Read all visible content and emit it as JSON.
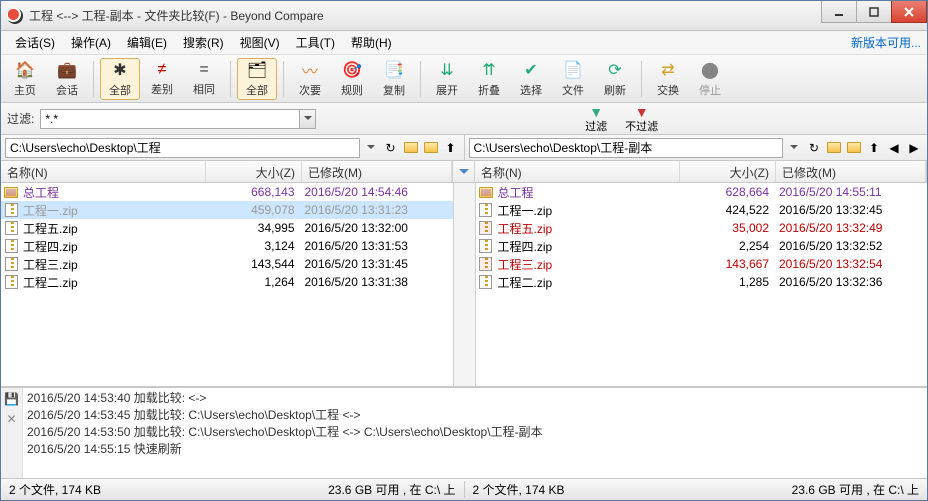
{
  "title": "工程 <--> 工程-副本 - 文件夹比较(F) - Beyond Compare",
  "update_link": "新版本可用...",
  "menu": [
    "会话(S)",
    "操作(A)",
    "编辑(E)",
    "搜索(R)",
    "视图(V)",
    "工具(T)",
    "帮助(H)"
  ],
  "toolbar": {
    "home": "主页",
    "session": "会话",
    "all": "全部",
    "diff": "差别",
    "same": "相同",
    "all2": "全部",
    "next": "次要",
    "rules": "规则",
    "copy": "复制",
    "expand": "展开",
    "collapse": "折叠",
    "select": "选择",
    "file": "文件",
    "refresh": "刷新",
    "swap": "交换",
    "stop": "停止"
  },
  "filter": {
    "label": "过滤:",
    "value": "*.*",
    "apply": "过滤",
    "unapply": "不过滤"
  },
  "paths": {
    "left": "C:\\Users\\echo\\Desktop\\工程",
    "right": "C:\\Users\\echo\\Desktop\\工程-副本"
  },
  "columns": {
    "name": "名称(N)",
    "size": "大小(Z)",
    "modified": "已修改(M)"
  },
  "left_rows": [
    {
      "type": "dir",
      "name": "总工程",
      "size": "668,143",
      "mod": "2016/5/20 14:54:46",
      "cls": "dir"
    },
    {
      "type": "zip",
      "name": "工程一.zip",
      "size": "459,078",
      "mod": "2016/5/20 13:31:23",
      "cls": "ghost selected"
    },
    {
      "type": "zip",
      "name": "工程五.zip",
      "size": "34,995",
      "mod": "2016/5/20 13:32:00",
      "cls": ""
    },
    {
      "type": "zip",
      "name": "工程四.zip",
      "size": "3,124",
      "mod": "2016/5/20 13:31:53",
      "cls": ""
    },
    {
      "type": "zip",
      "name": "工程三.zip",
      "size": "143,544",
      "mod": "2016/5/20 13:31:45",
      "cls": ""
    },
    {
      "type": "zip",
      "name": "工程二.zip",
      "size": "1,264",
      "mod": "2016/5/20 13:31:38",
      "cls": ""
    }
  ],
  "right_rows": [
    {
      "type": "dir",
      "name": "总工程",
      "size": "628,664",
      "mod": "2016/5/20 14:55:11",
      "cls": "dir"
    },
    {
      "type": "zip",
      "name": "工程一.zip",
      "size": "424,522",
      "mod": "2016/5/20 13:32:45",
      "cls": ""
    },
    {
      "type": "zip",
      "name": "工程五.zip",
      "size": "35,002",
      "mod": "2016/5/20 13:32:49",
      "cls": "diff"
    },
    {
      "type": "zip",
      "name": "工程四.zip",
      "size": "2,254",
      "mod": "2016/5/20 13:32:52",
      "cls": ""
    },
    {
      "type": "zip",
      "name": "工程三.zip",
      "size": "143,667",
      "mod": "2016/5/20 13:32:54",
      "cls": "diff"
    },
    {
      "type": "zip",
      "name": "工程二.zip",
      "size": "1,285",
      "mod": "2016/5/20 13:32:36",
      "cls": ""
    }
  ],
  "log": [
    "2016/5/20 14:53:40  加载比较:  <->",
    "2016/5/20 14:53:45  加载比较:  C:\\Users\\echo\\Desktop\\工程 <->",
    "2016/5/20 14:53:50  加载比较:  C:\\Users\\echo\\Desktop\\工程 <-> C:\\Users\\echo\\Desktop\\工程-副本",
    "2016/5/20 14:55:15  快速刷新"
  ],
  "status": {
    "left_files": "2 个文件, 174 KB",
    "left_disk": "23.6 GB 可用 , 在 C:\\ 上",
    "right_files": "2 个文件, 174 KB",
    "right_disk": "23.6 GB 可用 , 在 C:\\ 上"
  }
}
